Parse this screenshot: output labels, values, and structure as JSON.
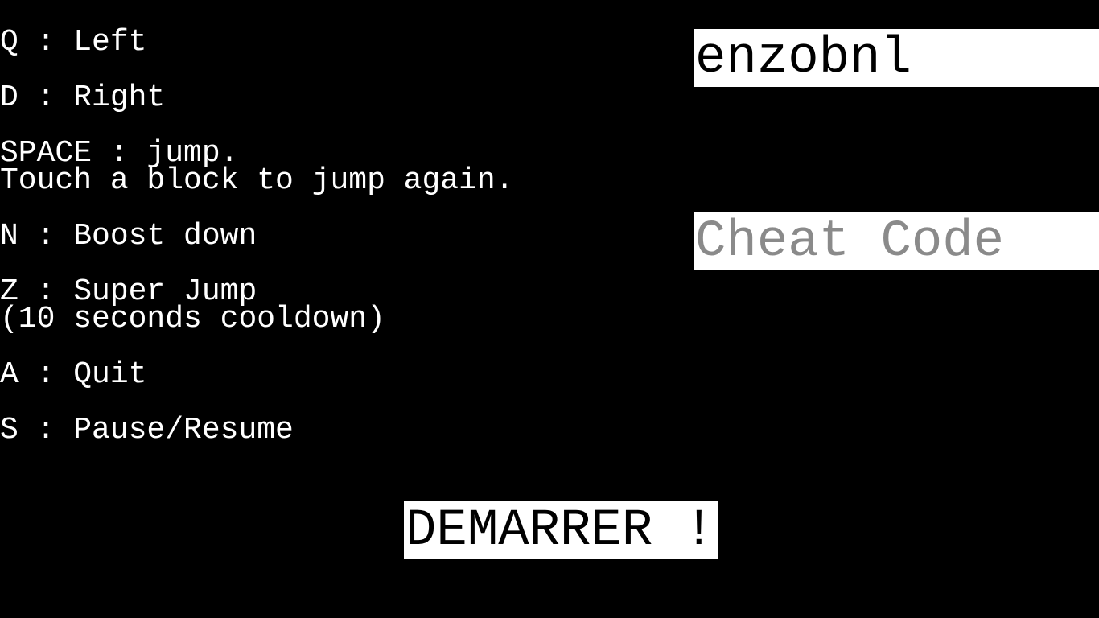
{
  "controls": {
    "q": "Q : Left",
    "d": "D : Right",
    "space_line1": "SPACE : jump.",
    "space_line2": "Touch a block to jump again.",
    "n": "N : Boost down",
    "z_line1": "Z : Super Jump",
    "z_line2": "(10 seconds cooldown)",
    "a": "A : Quit",
    "s": "S : Pause/Resume"
  },
  "username_field": {
    "value": "enzobnl"
  },
  "cheat_field": {
    "placeholder": "Cheat Code"
  },
  "start_button": {
    "label": "DEMARRER !"
  },
  "colors": {
    "background": "#000000",
    "text": "#ffffff",
    "field_background": "#ffffff",
    "field_text": "#000000",
    "placeholder_text": "#8a8a8a"
  }
}
